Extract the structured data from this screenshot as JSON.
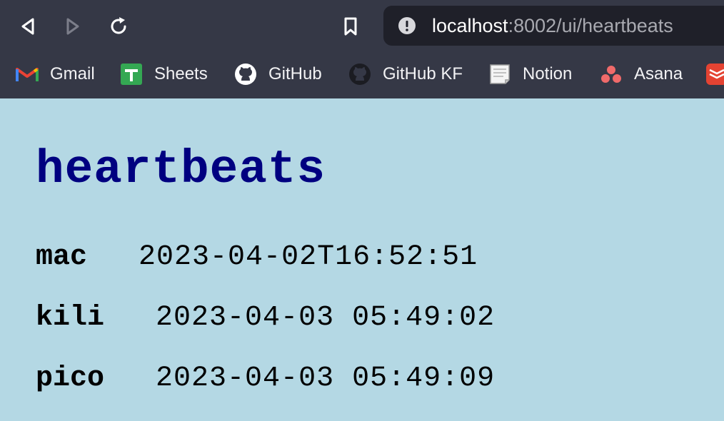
{
  "browser": {
    "url_host": "localhost",
    "url_rest": ":8002/ui/heartbeats",
    "nav_icons": [
      "back-icon",
      "forward-icon",
      "reload-icon",
      "bookmark-icon",
      "site-info-icon"
    ]
  },
  "bookmarks": [
    {
      "label": "Gmail",
      "icon": "gmail-icon"
    },
    {
      "label": "Sheets",
      "icon": "sheets-icon"
    },
    {
      "label": "GitHub",
      "icon": "github-icon"
    },
    {
      "label": "GitHub KF",
      "icon": "github-icon"
    },
    {
      "label": "Notion",
      "icon": "notion-icon"
    },
    {
      "label": "Asana",
      "icon": "asana-icon"
    },
    {
      "label": "",
      "icon": "todoist-icon"
    }
  ],
  "page": {
    "title": "heartbeats",
    "rows": [
      {
        "host": "mac",
        "time": "2023-04-02T16:52:51"
      },
      {
        "host": "kili",
        "time": "2023-04-03 05:49:02"
      },
      {
        "host": "pico",
        "time": "2023-04-03 05:49:09"
      }
    ]
  },
  "colors": {
    "chrome_bg": "#353846",
    "urlbar_bg": "#1f2029",
    "page_bg": "#b4d8e4",
    "title": "#000080"
  }
}
